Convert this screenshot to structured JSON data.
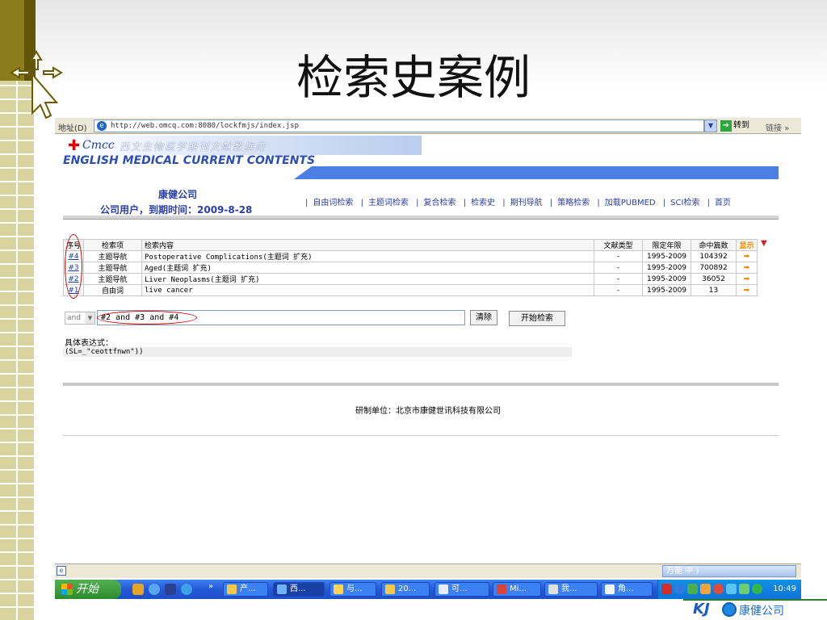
{
  "slide": {
    "title": "检索史案例"
  },
  "browser": {
    "address_label": "地址(D)",
    "url": "http://web.omcq.com:8080/lockfmjs/index.jsp",
    "go_label": "转到",
    "links_label": "链接",
    "links_chevron": "»"
  },
  "site": {
    "logo_emcc": "Cmcc",
    "logo_cn": "西文生物医学期刊文献数据库",
    "logo_en": "ENGLISH MEDICAL CURRENT CONTENTS",
    "company": "康健公司",
    "user_line": "公司用户，到期时间：2009-8-28",
    "nav": [
      "自由词检索",
      "主题词检索",
      "复合检索",
      "检索史",
      "期刊导航",
      "策略检索",
      "加载PUBMED",
      "SCI检索",
      "首页"
    ]
  },
  "history": {
    "headers": [
      "序号",
      "检索项",
      "检索内容",
      "文献类型",
      "限定年限",
      "命中篇数",
      "显示"
    ],
    "rows": [
      {
        "no": "#4",
        "item": "主题导航",
        "content": "Postoperative Complications(主题词 扩充)",
        "type": "-",
        "years": "1995-2009",
        "count": "104392",
        "show": "➡"
      },
      {
        "no": "#3",
        "item": "主题导航",
        "content": "Aged(主题词 扩充)",
        "type": "-",
        "years": "1995-2009",
        "count": "700892",
        "show": "➡"
      },
      {
        "no": "#2",
        "item": "主题导航",
        "content": "Liver Neoplasms(主题词 扩充)",
        "type": "-",
        "years": "1995-2009",
        "count": "36052",
        "show": "➡"
      },
      {
        "no": "#1",
        "item": "自由词",
        "content": "live cancer",
        "type": "-",
        "years": "1995-2009",
        "count": "13",
        "show": "➡"
      }
    ]
  },
  "query": {
    "operator": "and",
    "value": "#2 and #3 and #4",
    "clear_label": "清除",
    "search_label": "开始检索",
    "expr_label": "具体表达式：",
    "expr_value": "(SL=_\"ceottfnwn\"))"
  },
  "footer": {
    "text": "研制单位：北京市康健世讯科技有限公司"
  },
  "taskbar": {
    "start_label": "开始",
    "tasks": [
      "产...",
      "西...",
      "与...",
      "20...",
      "可...",
      "Mi...",
      "我...",
      "角..."
    ],
    "ime_label": "万能 中 )",
    "clock": "10:49"
  },
  "corner_logo": {
    "mark": "KJ",
    "name": "康健公司"
  },
  "colors": {
    "accent_blue": "#2b3fa8",
    "olive": "#8c7d1c",
    "alert_red": "#d00000",
    "arrow_orange": "#f08c00"
  }
}
